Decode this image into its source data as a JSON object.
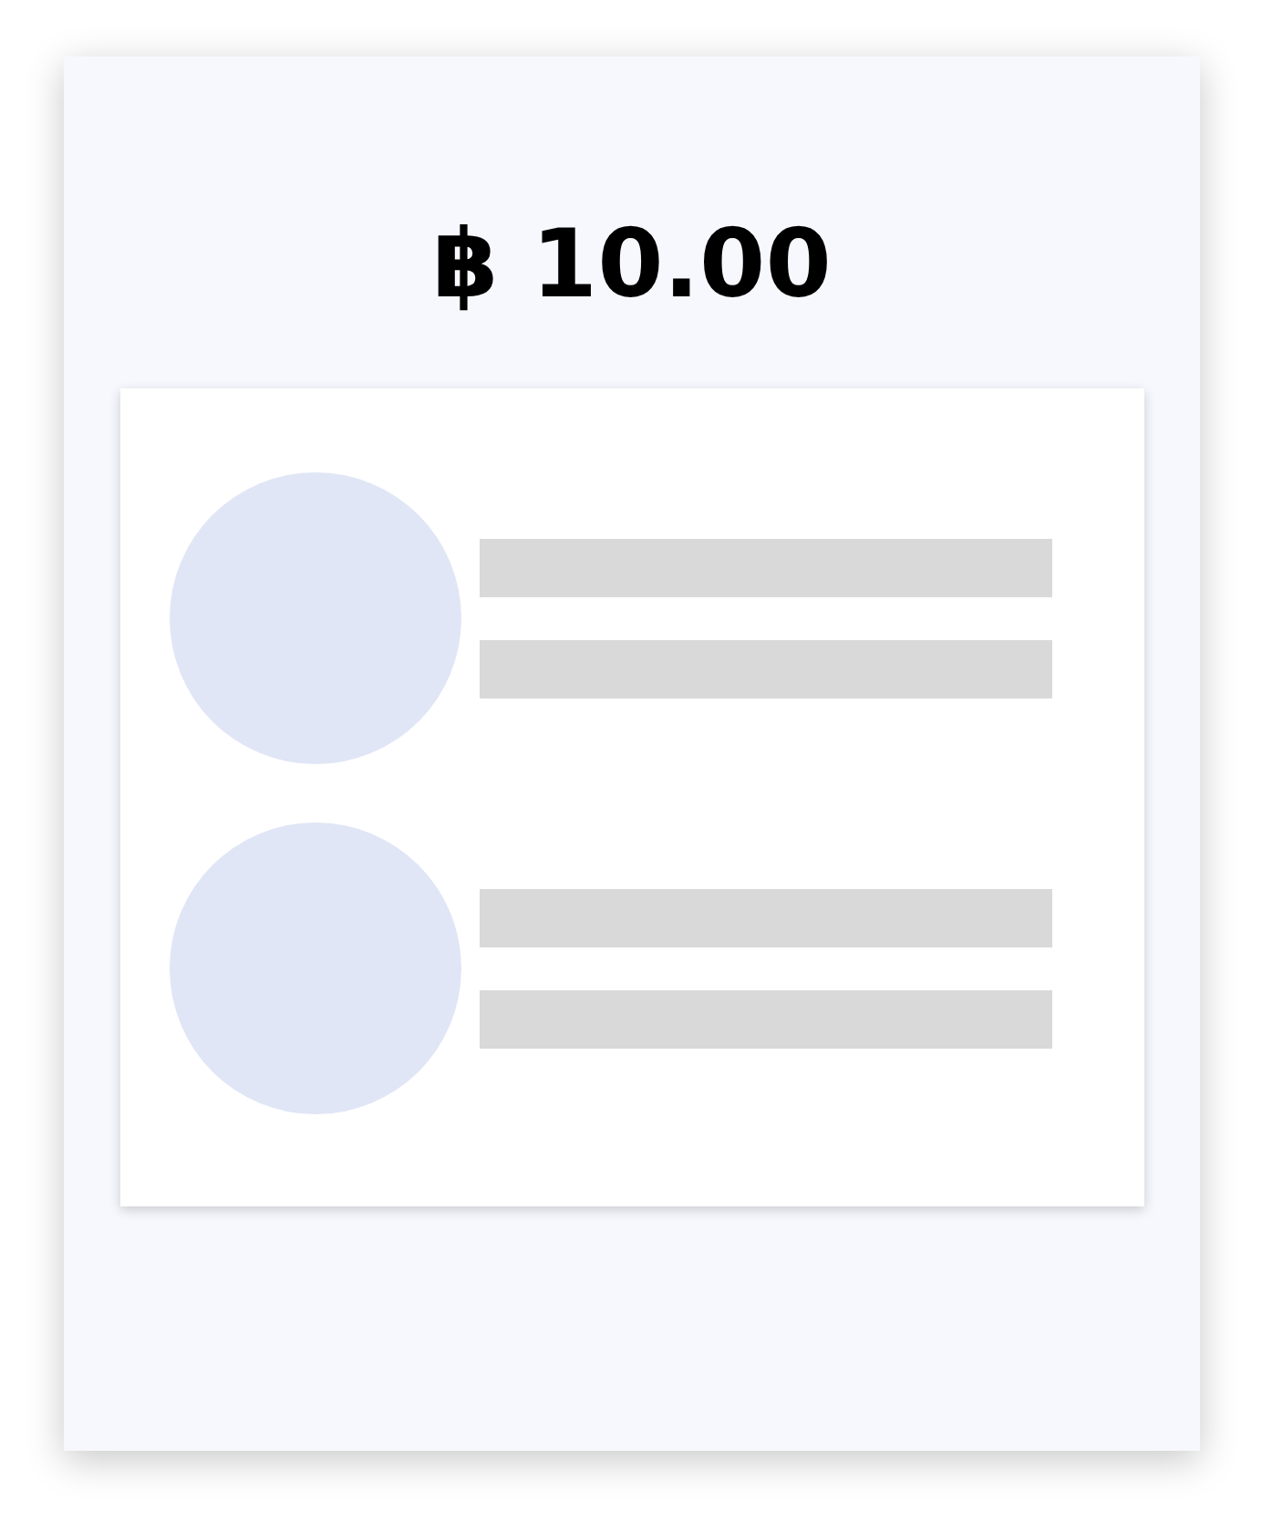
{
  "price": "฿ 10.00",
  "list_items": [
    {
      "kind": "placeholder"
    },
    {
      "kind": "placeholder"
    }
  ]
}
